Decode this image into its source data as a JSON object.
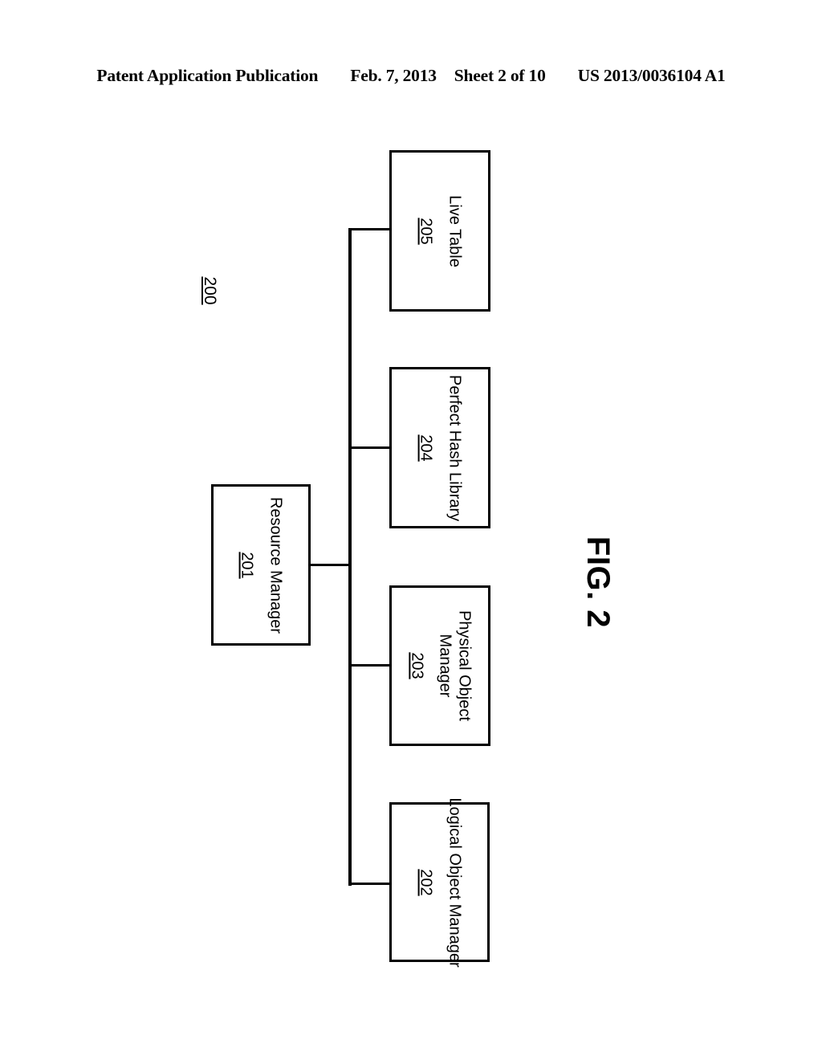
{
  "header": {
    "publication": "Patent Application Publication",
    "date": "Feb. 7, 2013",
    "sheet": "Sheet 2 of 10",
    "patent_number": "US 2013/0036104 A1"
  },
  "figure": {
    "title": "FIG. 2",
    "diagram_reference": "200"
  },
  "diagram": {
    "type": "block-diagram",
    "orientation": "rotated-90-clockwise",
    "root": {
      "label": "Resource Manager",
      "ref": "201"
    },
    "children": [
      {
        "label": "Logical Object Manager",
        "ref": "202",
        "lines": [
          "Logical Object Manager"
        ]
      },
      {
        "label": "Physical Object Manager",
        "ref": "203",
        "lines": [
          "Physical Object",
          "Manager"
        ]
      },
      {
        "label": "Perfect Hash Library",
        "ref": "204",
        "lines": [
          "Perfect Hash Library"
        ]
      },
      {
        "label": "Live Table",
        "ref": "205",
        "lines": [
          "Live Table"
        ]
      }
    ],
    "colors": {
      "stroke": "#000000",
      "fill": "#ffffff"
    }
  }
}
